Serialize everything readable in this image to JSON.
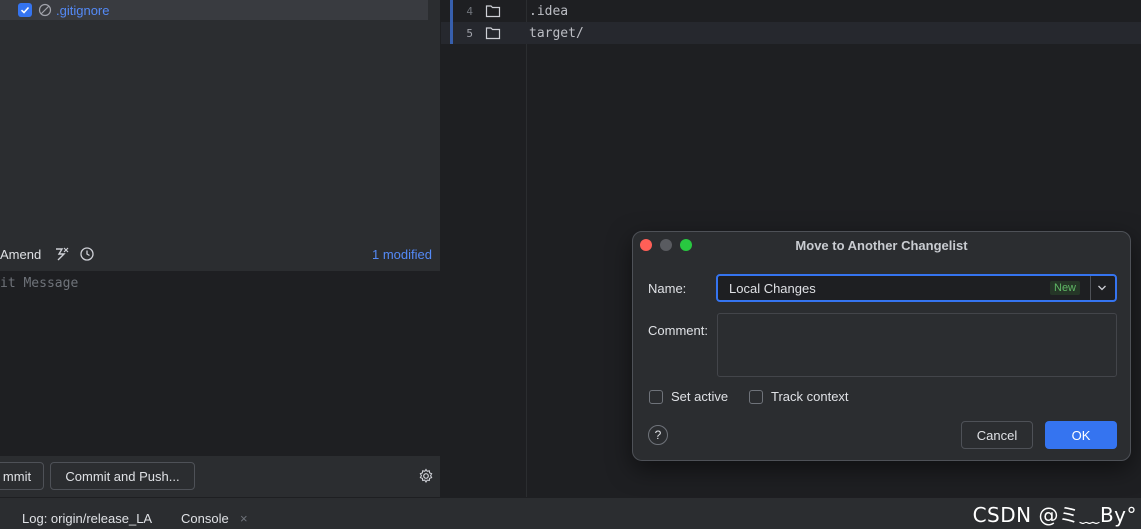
{
  "changes": {
    "file_name": ".gitignore"
  },
  "commit": {
    "amend_label": "Amend",
    "modified_count": "1 modified",
    "message_placeholder": "it Message",
    "commit_button": "mmit",
    "commit_push_button": "Commit and Push..."
  },
  "editor": {
    "lines": [
      {
        "number": "4",
        "text": ".idea"
      },
      {
        "number": "5",
        "text": "target/"
      }
    ]
  },
  "statusbar": {
    "log_tab": "Log: origin/release_LA",
    "console_tab": "Console",
    "close_glyph": "×"
  },
  "watermark": "CSDN @ミ﹏By°",
  "dialog": {
    "title": "Move to Another Changelist",
    "name_label": "Name:",
    "name_value": "Local Changes",
    "new_badge": "New",
    "comment_label": "Comment:",
    "set_active_label": "Set active",
    "track_context_label": "Track context",
    "help_glyph": "?",
    "cancel_label": "Cancel",
    "ok_label": "OK"
  },
  "colors": {
    "accent": "#3574f0",
    "link": "#548af7",
    "new_badge": "#5fb865"
  }
}
